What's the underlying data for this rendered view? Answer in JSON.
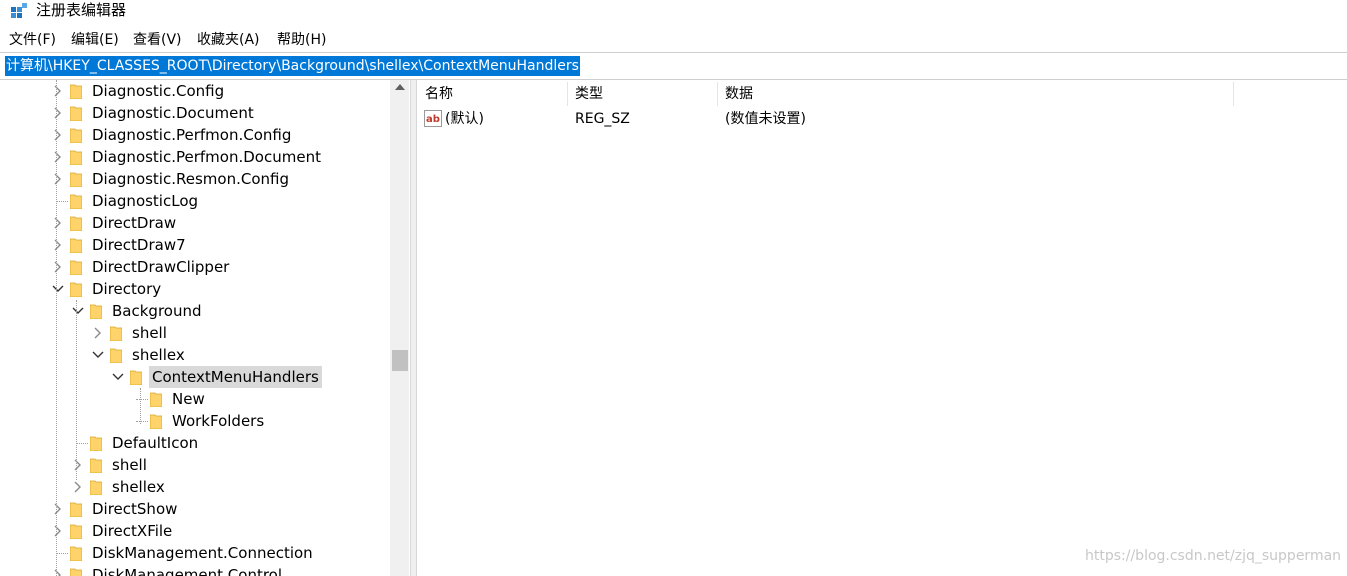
{
  "window": {
    "title": "注册表编辑器"
  },
  "menu": [
    "文件(F)",
    "编辑(E)",
    "查看(V)",
    "收藏夹(A)",
    "帮助(H)"
  ],
  "address": "计算机\\HKEY_CLASSES_ROOT\\Directory\\Background\\shellex\\ContextMenuHandlers",
  "tree": [
    {
      "label": "Diagnostic.Config",
      "state": "collapsed"
    },
    {
      "label": "Diagnostic.Document",
      "state": "collapsed"
    },
    {
      "label": "Diagnostic.Perfmon.Config",
      "state": "collapsed"
    },
    {
      "label": "Diagnostic.Perfmon.Document",
      "state": "collapsed"
    },
    {
      "label": "Diagnostic.Resmon.Config",
      "state": "collapsed"
    },
    {
      "label": "DiagnosticLog",
      "state": "leaf"
    },
    {
      "label": "DirectDraw",
      "state": "collapsed"
    },
    {
      "label": "DirectDraw7",
      "state": "collapsed"
    },
    {
      "label": "DirectDrawClipper",
      "state": "collapsed"
    },
    {
      "label": "Directory",
      "state": "expanded"
    },
    {
      "label": "Background",
      "state": "expanded"
    },
    {
      "label": "shell",
      "state": "collapsed"
    },
    {
      "label": "shellex",
      "state": "expanded"
    },
    {
      "label": "ContextMenuHandlers",
      "state": "expanded",
      "selected": true
    },
    {
      "label": "New",
      "state": "leaf"
    },
    {
      "label": "WorkFolders",
      "state": "leaf"
    },
    {
      "label": "DefaultIcon",
      "state": "leaf"
    },
    {
      "label": "shell",
      "state": "collapsed"
    },
    {
      "label": "shellex",
      "state": "collapsed"
    },
    {
      "label": "DirectShow",
      "state": "collapsed"
    },
    {
      "label": "DirectXFile",
      "state": "collapsed"
    },
    {
      "label": "DiskManagement.Connection",
      "state": "leaf"
    },
    {
      "label": "DiskManagement.Control",
      "state": "collapsed"
    }
  ],
  "list": {
    "columns": [
      "名称",
      "类型",
      "数据"
    ],
    "rows": [
      {
        "name": "(默认)",
        "type": "REG_SZ",
        "data": "(数值未设置)",
        "icon": "string-value-icon"
      }
    ]
  },
  "watermark": "https://blog.csdn.net/zjq_supperman",
  "colors": {
    "selection": "#0078d7",
    "folder": "#ffd36b",
    "tree_selected": "#d9d9d9"
  }
}
